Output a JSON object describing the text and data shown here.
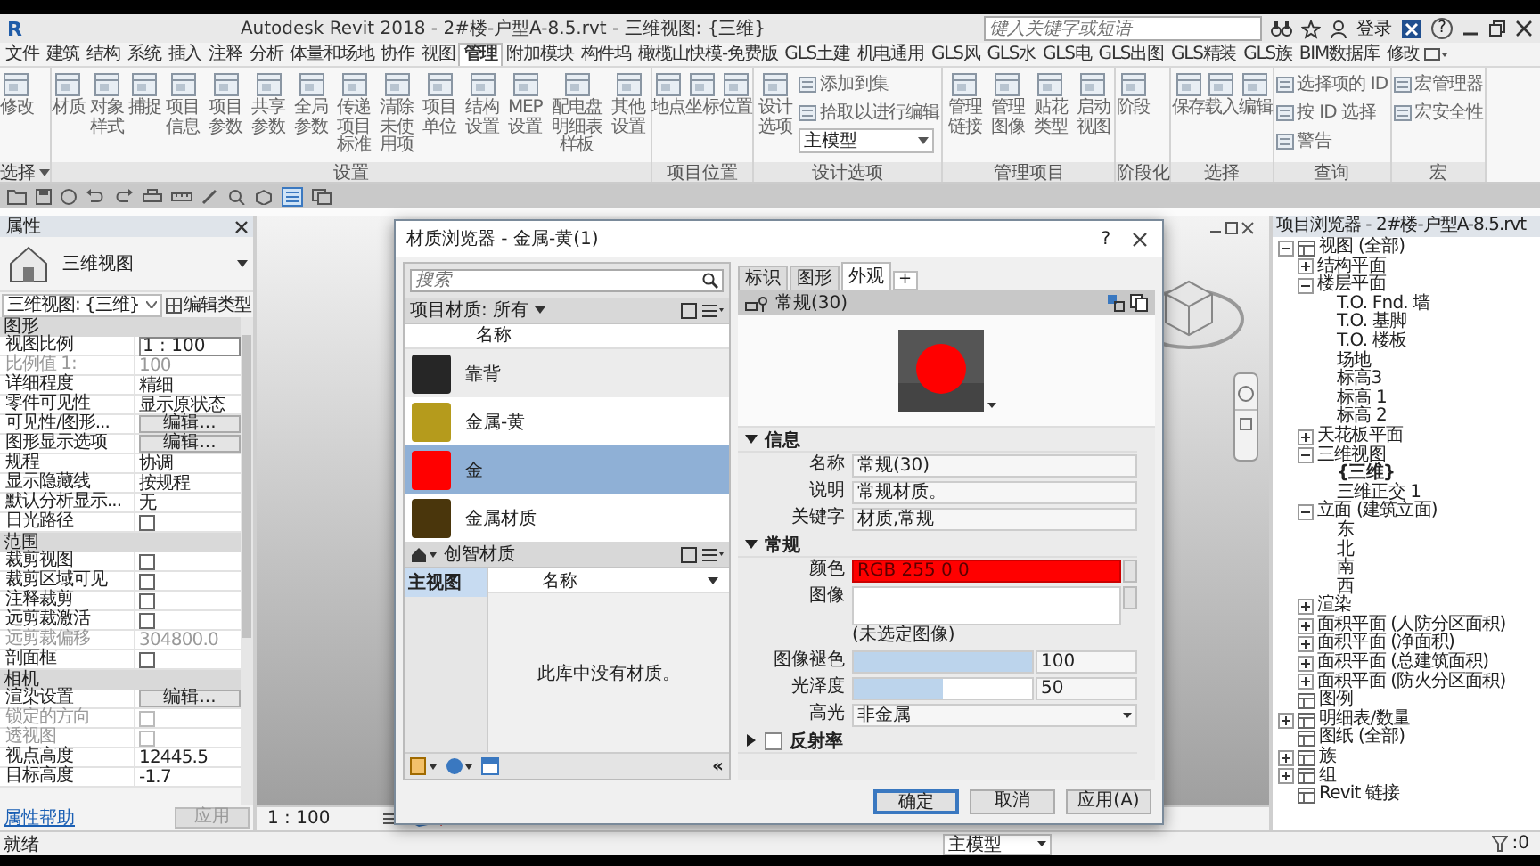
{
  "title_bar": {
    "logo": "R",
    "title": "Autodesk Revit 2018 - 2#楼-户型A-8.5.rvt - 三维视图: {三维}",
    "search_placeholder": "键入关键字或短语",
    "sign_in": "登录",
    "help": "?"
  },
  "ribbon_tabs": [
    {
      "label": "文件",
      "selected": false
    },
    {
      "label": "建筑",
      "selected": false
    },
    {
      "label": "结构",
      "selected": false
    },
    {
      "label": "系统",
      "selected": false
    },
    {
      "label": "插入",
      "selected": false
    },
    {
      "label": "注释",
      "selected": false
    },
    {
      "label": "分析",
      "selected": false
    },
    {
      "label": "体量和场地",
      "selected": false
    },
    {
      "label": "协作",
      "selected": false
    },
    {
      "label": "视图",
      "selected": false
    },
    {
      "label": "管理",
      "selected": true
    },
    {
      "label": "附加模块",
      "selected": false
    },
    {
      "label": "构件坞",
      "selected": false
    },
    {
      "label": "橄榄山快模-免费版",
      "selected": false
    },
    {
      "label": "GLS土建",
      "selected": false
    },
    {
      "label": "机电通用",
      "selected": false
    },
    {
      "label": "GLS风",
      "selected": false
    },
    {
      "label": "GLS水",
      "selected": false
    },
    {
      "label": "GLS电",
      "selected": false
    },
    {
      "label": "GLS出图",
      "selected": false
    },
    {
      "label": "GLS精装",
      "selected": false
    },
    {
      "label": "GLS族",
      "selected": false
    },
    {
      "label": "BIM数据库",
      "selected": false
    },
    {
      "label": "修改",
      "selected": false
    }
  ],
  "ribbon_panels": [
    {
      "label": "选择",
      "menu": true,
      "items": [
        "修改"
      ]
    },
    {
      "label": "设置",
      "items": [
        "材质",
        "对象样式",
        "捕捉",
        "项目信息",
        "项目参数",
        "共享参数",
        "全局参数",
        "传递项目标准",
        "清除未使用项",
        "项目单位",
        "结构设置",
        "MEP设置",
        "配电盘明细表样板",
        "其他设置"
      ]
    },
    {
      "label": "项目位置",
      "items": [
        "地点",
        "坐标",
        "位置"
      ]
    },
    {
      "label": "设计选项",
      "items": [
        "设计选项"
      ],
      "stack": [
        {
          "kind": "small",
          "label": "添加到集"
        },
        {
          "kind": "small",
          "label": "拾取以进行编辑"
        },
        {
          "kind": "dropdown",
          "value": "主模型"
        }
      ]
    },
    {
      "label": "管理项目",
      "items": [
        "管理链接",
        "管理图像",
        "贴花类型",
        "启动视图"
      ]
    },
    {
      "label": "阶段化",
      "items": [
        "阶段"
      ]
    },
    {
      "label": "选择",
      "items": [
        "保存",
        "载入",
        "编辑"
      ]
    },
    {
      "label": "查询",
      "stack": [
        {
          "kind": "small",
          "label": "选择项的 ID"
        },
        {
          "kind": "small",
          "label": "按 ID 选择"
        },
        {
          "kind": "small",
          "label": "警告"
        }
      ]
    },
    {
      "label": "宏",
      "stack": [
        {
          "kind": "small",
          "label": "宏管理器"
        },
        {
          "kind": "small",
          "label": "宏安全性"
        }
      ]
    }
  ],
  "properties": {
    "title": "属性",
    "type_name": "三维视图",
    "view_selector": "三维视图: {三维}",
    "edit_type": "编辑类型",
    "sections": [
      {
        "title": "图形",
        "rows": [
          {
            "label": "视图比例",
            "kind": "field",
            "value": "1 : 100",
            "disabled": false
          },
          {
            "label": "比例值 1:",
            "kind": "text",
            "value": "100",
            "disabled": true
          },
          {
            "label": "详细程度",
            "kind": "text",
            "value": "精细",
            "disabled": false
          },
          {
            "label": "零件可见性",
            "kind": "text",
            "value": "显示原状态",
            "disabled": false
          },
          {
            "label": "可见性/图形...",
            "kind": "button",
            "value": "编辑...",
            "disabled": false
          },
          {
            "label": "图形显示选项",
            "kind": "button",
            "value": "编辑...",
            "disabled": false
          },
          {
            "label": "规程",
            "kind": "text",
            "value": "协调",
            "disabled": false
          },
          {
            "label": "显示隐藏线",
            "kind": "text",
            "value": "按规程",
            "disabled": false
          },
          {
            "label": "默认分析显示...",
            "kind": "text",
            "value": "无",
            "disabled": false
          },
          {
            "label": "日光路径",
            "kind": "checkbox",
            "checked": false,
            "disabled": false
          }
        ]
      },
      {
        "title": "范围",
        "rows": [
          {
            "label": "裁剪视图",
            "kind": "checkbox",
            "checked": false,
            "disabled": false
          },
          {
            "label": "裁剪区域可见",
            "kind": "checkbox",
            "checked": false,
            "disabled": false
          },
          {
            "label": "注释裁剪",
            "kind": "checkbox",
            "checked": false,
            "disabled": false
          },
          {
            "label": "远剪裁激活",
            "kind": "checkbox",
            "checked": false,
            "disabled": false
          },
          {
            "label": "远剪裁偏移",
            "kind": "text",
            "value": "304800.0",
            "disabled": true
          },
          {
            "label": "剖面框",
            "kind": "checkbox",
            "checked": false,
            "disabled": false
          }
        ]
      },
      {
        "title": "相机",
        "rows": [
          {
            "label": "渲染设置",
            "kind": "button",
            "value": "编辑...",
            "disabled": false
          },
          {
            "label": "锁定的方向",
            "kind": "checkbox",
            "checked": false,
            "disabled": true
          },
          {
            "label": "透视图",
            "kind": "checkbox",
            "checked": false,
            "disabled": true
          },
          {
            "label": "视点高度",
            "kind": "text",
            "value": "12445.5",
            "disabled": false
          },
          {
            "label": "目标高度",
            "kind": "text",
            "value": "-1.7",
            "disabled": false
          }
        ]
      }
    ],
    "help_link": "属性帮助",
    "apply": {
      "label": "应用",
      "disabled": true
    }
  },
  "viewport": {
    "scale": "1 : 100"
  },
  "material_browser": {
    "title": "材质浏览器 - 金属-黄(1)",
    "help": "?",
    "search_placeholder": "搜索",
    "filter": "项目材质: 所有",
    "list_header": "名称",
    "materials": [
      {
        "name": "靠背",
        "color": "#262626",
        "selected": false
      },
      {
        "name": "金属-黄",
        "color": "#b59b1c",
        "selected": false
      },
      {
        "name": "金",
        "color": "#ff0000",
        "selected": true
      },
      {
        "name": "金属材质",
        "color": "#4a360c",
        "selected": false
      }
    ],
    "library_breadcrumb": "创智材质",
    "libraries": [
      {
        "label": "主视图",
        "selected": true
      }
    ],
    "library_header": "名称",
    "library_empty": "此库中没有材质。",
    "collapse": "«",
    "tabs": [
      {
        "label": "标识",
        "selected": false
      },
      {
        "label": "图形",
        "selected": false
      },
      {
        "label": "外观",
        "selected": true
      }
    ],
    "add_tab": "+",
    "asset_name": "常规(30)",
    "sections": [
      {
        "title": "信息",
        "expanded": true,
        "rows": [
          {
            "kind": "text",
            "label": "名称",
            "value": "常规(30)"
          },
          {
            "kind": "text",
            "label": "说明",
            "value": "常规材质。"
          },
          {
            "kind": "text",
            "label": "关键字",
            "value": "材质,常规"
          }
        ]
      },
      {
        "title": "常规",
        "expanded": true,
        "rows": [
          {
            "kind": "color",
            "label": "颜色",
            "value": "RGB 255 0 0",
            "color": "#ff0000"
          },
          {
            "kind": "image",
            "label": "图像",
            "note": "(未选定图像)"
          },
          {
            "kind": "slider",
            "label": "图像褪色",
            "level": 1,
            "value": "100"
          },
          {
            "kind": "slider",
            "label": "光泽度",
            "level": 0.5,
            "value": "50"
          },
          {
            "kind": "dropdown",
            "label": "高光",
            "value": "非金属"
          }
        ]
      },
      {
        "title": "反射率",
        "expanded": false,
        "checked": false
      }
    ],
    "buttons": [
      {
        "label": "确定",
        "default": true
      },
      {
        "label": "取消",
        "default": false
      },
      {
        "label": "应用(A)",
        "default": false
      }
    ]
  },
  "project_browser": {
    "title": "项目浏览器 - 2#楼-户型A-8.5.rvt",
    "tree": [
      {
        "label": "视图 (全部)",
        "expanded": true,
        "children": [
          {
            "label": "结构平面",
            "expanded": false
          },
          {
            "label": "楼层平面",
            "expanded": true,
            "children": [
              {
                "label": "T.O. Fnd. 墙"
              },
              {
                "label": "T.O. 基脚"
              },
              {
                "label": "T.O. 楼板"
              },
              {
                "label": "场地"
              },
              {
                "label": "标高3"
              },
              {
                "label": "标高 1"
              },
              {
                "label": "标高 2"
              }
            ]
          },
          {
            "label": "天花板平面",
            "expanded": false
          },
          {
            "label": "三维视图",
            "expanded": true,
            "children": [
              {
                "label": "{三维}",
                "active": true
              },
              {
                "label": "三维正交 1"
              }
            ]
          },
          {
            "label": "立面 (建筑立面)",
            "expanded": true,
            "children": [
              {
                "label": "东"
              },
              {
                "label": "北"
              },
              {
                "label": "南"
              },
              {
                "label": "西"
              }
            ]
          },
          {
            "label": "渲染",
            "expanded": false
          },
          {
            "label": "面积平面 (人防分区面积)",
            "expanded": false
          },
          {
            "label": "面积平面 (净面积)",
            "expanded": false
          },
          {
            "label": "面积平面 (总建筑面积)",
            "expanded": false
          },
          {
            "label": "面积平面 (防火分区面积)",
            "expanded": false
          }
        ]
      },
      {
        "label": "图例"
      },
      {
        "label": "明细表/数量",
        "expanded": false
      },
      {
        "label": "图纸 (全部)"
      },
      {
        "label": "族",
        "expanded": false
      },
      {
        "label": "组",
        "expanded": false
      },
      {
        "label": "Revit 链接"
      }
    ]
  },
  "status_bar": {
    "text": "就绪",
    "design_option": "主模型",
    "filter_count": ":0"
  }
}
